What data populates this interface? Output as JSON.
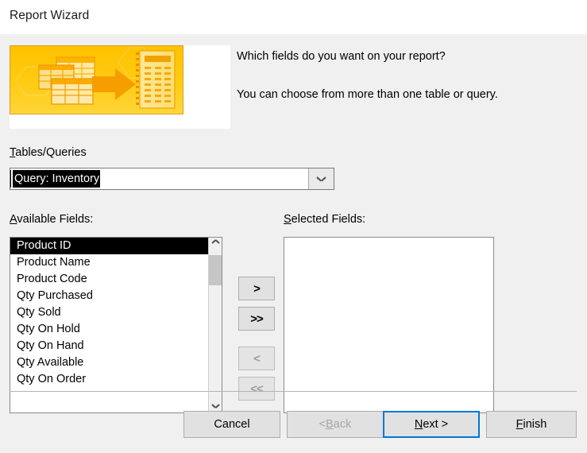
{
  "window": {
    "title": "Report Wizard"
  },
  "prompt": {
    "line1": "Which fields do you want on your report?",
    "line2": "You can choose from more than one table or query."
  },
  "banner": {
    "icon_name": "report-wizard-banner-icon",
    "colors": {
      "background_start": "#ffc400",
      "background_end": "#ffd530",
      "border": "#d6a020",
      "accent_orange": "#f09000",
      "table_light": "#ffe08a"
    }
  },
  "tables_queries": {
    "label_prefix": "T",
    "label_rest": "ables/Queries",
    "label_full": "Tables/Queries",
    "selected_value": "Query: Inventory",
    "dropdown_icon": "chevron-down-icon"
  },
  "available": {
    "label_prefix": "A",
    "label_rest": "vailable Fields:",
    "label_full": "Available Fields:",
    "selected_index": 0,
    "items": [
      "Product ID",
      "Product Name",
      "Product Code",
      "Qty Purchased",
      "Qty Sold",
      "Qty On Hold",
      "Qty On Hand",
      "Qty Available",
      "Qty On Order"
    ],
    "scrollbar": {
      "up_icon": "chevron-up-icon",
      "down_icon": "chevron-down-icon"
    }
  },
  "selected": {
    "label_prefix": "S",
    "label_rest": "elected Fields:",
    "label_full": "Selected Fields:",
    "items": []
  },
  "transfer_buttons": [
    {
      "name": "add-field-button",
      "label": ">",
      "enabled": true
    },
    {
      "name": "add-all-fields-button",
      "label": ">>",
      "enabled": true
    },
    {
      "name": "remove-field-button",
      "label": "<",
      "enabled": false
    },
    {
      "name": "remove-all-fields-button",
      "label": "<<",
      "enabled": false
    }
  ],
  "footer": {
    "cancel": "Cancel",
    "back": "< Back",
    "back_prefix": "< ",
    "back_accel": "B",
    "back_rest": "ack",
    "next_prefix": "",
    "next_accel": "N",
    "next_rest": "ext >",
    "next": "Next >",
    "finish_accel": "F",
    "finish_rest": "inish",
    "finish": "Finish",
    "focus_color": "#0078d7"
  }
}
